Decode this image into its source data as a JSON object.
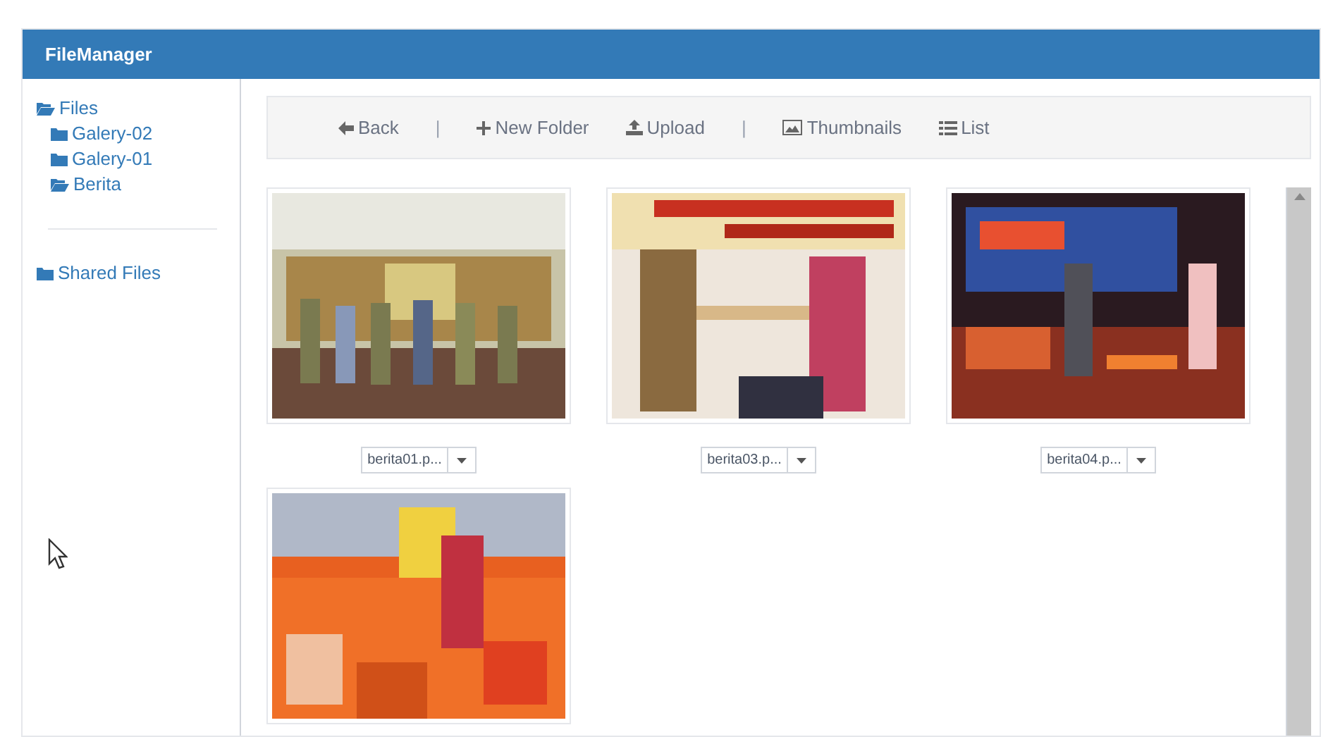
{
  "window": {
    "title": "FileManager"
  },
  "sidebar": {
    "tree": [
      {
        "label": "Files",
        "expanded": true,
        "children": [
          {
            "label": "Galery-02",
            "expanded": false
          },
          {
            "label": "Galery-01",
            "expanded": false
          },
          {
            "label": "Berita",
            "expanded": true
          }
        ]
      }
    ],
    "shared": {
      "label": "Shared Files",
      "expanded": false
    }
  },
  "toolbar": [
    {
      "kind": "back",
      "label": "Back"
    },
    {
      "kind": "separator",
      "label": "|"
    },
    {
      "kind": "new-folder",
      "label": "New Folder"
    },
    {
      "kind": "upload",
      "label": "Upload"
    },
    {
      "kind": "separator",
      "label": "|"
    },
    {
      "kind": "thumbnails",
      "label": "Thumbnails"
    },
    {
      "kind": "list",
      "label": "List"
    }
  ],
  "files": [
    {
      "kind": "picture",
      "name": "berita01.p..."
    },
    {
      "kind": "picture",
      "name": "berita03.p..."
    },
    {
      "kind": "picture",
      "name": "berita04.p..."
    },
    {
      "kind": "picture"
    }
  ]
}
